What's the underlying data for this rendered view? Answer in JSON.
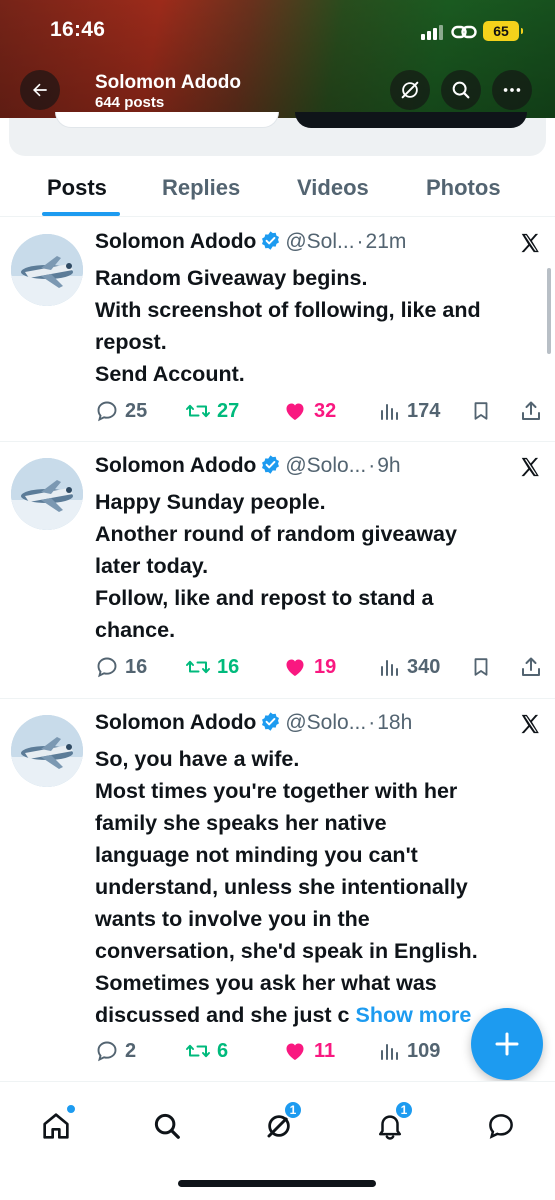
{
  "status_bar": {
    "time": "16:46",
    "battery": "65"
  },
  "header": {
    "name": "Solomon Adodo",
    "post_count": "644 posts"
  },
  "tabs": [
    {
      "label": "Posts",
      "active": true
    },
    {
      "label": "Replies",
      "active": false
    },
    {
      "label": "Videos",
      "active": false
    },
    {
      "label": "Photos",
      "active": false
    }
  ],
  "posts": [
    {
      "name": "Solomon Adodo",
      "handle": "@Sol...",
      "time": "21m",
      "lines": [
        "Random Giveaway begins.",
        "With screenshot of following, like and",
        "repost.",
        "Send Account."
      ],
      "show_more": "",
      "replies": "25",
      "reposts": "27",
      "likes": "32",
      "views": "174"
    },
    {
      "name": "Solomon Adodo",
      "handle": "@Solo...",
      "time": "9h",
      "lines": [
        "Happy Sunday people.",
        "Another round of random giveaway",
        "later today.",
        "Follow, like and repost to stand a",
        "chance."
      ],
      "show_more": "",
      "replies": "16",
      "reposts": "16",
      "likes": "19",
      "views": "340"
    },
    {
      "name": "Solomon Adodo",
      "handle": "@Solo...",
      "time": "18h",
      "lines": [
        "So,  you have a wife.",
        "Most times you're together with her",
        "family she speaks her native",
        "language not minding you can't",
        "understand, unless she intentionally",
        "wants to involve you in the",
        "conversation, she'd speak in English.",
        "Sometimes you ask her what was",
        "discussed and she just c"
      ],
      "show_more": "Show more",
      "replies": "2",
      "reposts": "6",
      "likes": "11",
      "views": "109"
    }
  ],
  "bottom_nav": {
    "grok_badge": "1",
    "notifications_badge": "1"
  },
  "icons": {
    "back": "arrow-left-icon",
    "grok": "grok-icon",
    "search": "search-icon",
    "more": "more-icon",
    "verified": "verified-badge-icon",
    "x_logo": "x-logo-icon",
    "reply": "reply-icon",
    "repost": "repost-icon",
    "like": "heart-icon",
    "views": "views-icon",
    "bookmark": "bookmark-icon",
    "share": "share-icon",
    "compose": "plus-icon",
    "home": "home-icon",
    "notifications": "bell-icon",
    "messages": "message-icon"
  },
  "colors": {
    "accent": "#1d9bf0",
    "repost": "#00ba7c",
    "like": "#f91880",
    "muted": "#536471",
    "battery": "#f4d21b"
  }
}
